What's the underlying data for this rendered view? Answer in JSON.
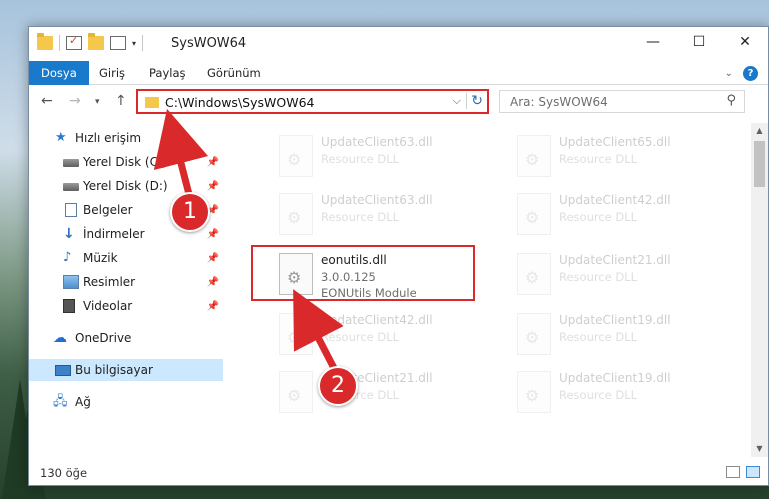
{
  "window": {
    "title": "SysWOW64"
  },
  "ribbon": {
    "tabs": [
      "Dosya",
      "Giriş",
      "Paylaş",
      "Görünüm"
    ]
  },
  "navigation": {
    "address": "C:\\Windows\\SysWOW64",
    "search_placeholder": "Ara: SysWOW64"
  },
  "sidebar": {
    "items": [
      {
        "label": "Hızlı erişim",
        "icon": "star-icon"
      },
      {
        "label": "Yerel Disk (C:)",
        "icon": "drive-icon",
        "pinned": true
      },
      {
        "label": "Yerel Disk (D:)",
        "icon": "drive-icon",
        "pinned": true
      },
      {
        "label": "Belgeler",
        "icon": "documents-icon",
        "pinned": true
      },
      {
        "label": "İndirmeler",
        "icon": "download-icon",
        "pinned": true
      },
      {
        "label": "Müzik",
        "icon": "music-icon",
        "pinned": true
      },
      {
        "label": "Resimler",
        "icon": "pictures-icon",
        "pinned": true
      },
      {
        "label": "Videolar",
        "icon": "video-icon",
        "pinned": true
      },
      {
        "label": "OneDrive",
        "icon": "cloud-icon"
      },
      {
        "label": "Bu bilgisayar",
        "icon": "computer-icon",
        "selected": true
      },
      {
        "label": "Ağ",
        "icon": "network-icon"
      }
    ]
  },
  "files": [
    {
      "name": "UpdateClient63.dll",
      "version": "",
      "description": "Resource DLL",
      "faded": true
    },
    {
      "name": "UpdateClient65.dll",
      "version": "",
      "description": "Resource DLL",
      "faded": true
    },
    {
      "name": "UpdateClient63.dll",
      "version": "",
      "description": "Resource DLL",
      "faded": true
    },
    {
      "name": "UpdateClient42.dll",
      "version": "",
      "description": "Resource DLL",
      "faded": true
    },
    {
      "name": "eonutils.dll",
      "version": "3.0.0.125",
      "description": "EONUtils Module",
      "faded": false
    },
    {
      "name": "UpdateClient21.dll",
      "version": "",
      "description": "Resource DLL",
      "faded": true
    },
    {
      "name": "UpdateClient42.dll",
      "version": "",
      "description": "Resource DLL",
      "faded": true
    },
    {
      "name": "UpdateClient19.dll",
      "version": "",
      "description": "Resource DLL",
      "faded": true
    },
    {
      "name": "UpdateClient21.dll",
      "version": "",
      "description": "Resource DLL",
      "faded": true
    },
    {
      "name": "UpdateClient19.dll",
      "version": "",
      "description": "Resource DLL",
      "faded": true
    }
  ],
  "status": {
    "item_count": "130 öğe"
  },
  "callouts": [
    "1",
    "2"
  ],
  "colors": {
    "accent": "#1979ca",
    "highlight": "#d9292b",
    "selection": "#cce8ff"
  }
}
